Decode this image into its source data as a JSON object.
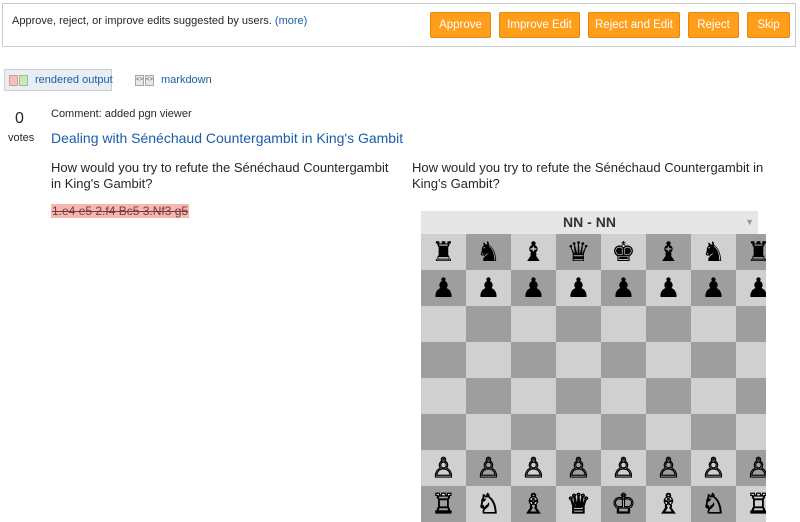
{
  "review": {
    "message": "Approve, reject, or improve edits suggested by users.",
    "more_link": "(more)",
    "buttons": {
      "approve": "Approve",
      "improve": "Improve Edit",
      "reject_edit": "Reject and Edit",
      "reject": "Reject",
      "skip": "Skip"
    },
    "button_color": "#ff9e1b"
  },
  "tabs": {
    "rendered": "rendered output",
    "markdown": "markdown"
  },
  "post": {
    "votes": "0",
    "votes_label": "votes",
    "comment": "Comment: added pgn viewer",
    "title": "Dealing with Sénéchaud Countergambit in King's Gambit",
    "body": "How would you try to refute the Sénéchaud Countergambit in King's Gambit?",
    "removed_pgn": "1.e4 e5 2.f4 Bc5 3.Nf3 g5"
  },
  "board": {
    "header": "NN - NN",
    "ranks": [
      [
        "♜",
        "♞",
        "♝",
        "♛",
        "♚",
        "♝",
        "♞",
        "♜"
      ],
      [
        "♟",
        "♟",
        "♟",
        "♟",
        "♟",
        "♟",
        "♟",
        "♟"
      ],
      [
        "",
        "",
        "",
        "",
        "",
        "",
        "",
        ""
      ],
      [
        "",
        "",
        "",
        "",
        "",
        "",
        "",
        ""
      ],
      [
        "",
        "",
        "",
        "",
        "",
        "",
        "",
        ""
      ],
      [
        "",
        "",
        "",
        "",
        "",
        "",
        "",
        ""
      ],
      [
        "♙",
        "♙",
        "♙",
        "♙",
        "♙",
        "♙",
        "♙",
        "♙"
      ],
      [
        "♖",
        "♘",
        "♗",
        "♕",
        "♔",
        "♗",
        "♘",
        "♖"
      ]
    ]
  }
}
